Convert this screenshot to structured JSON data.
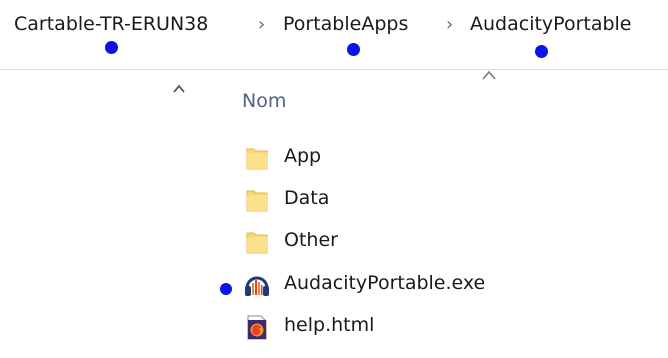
{
  "breadcrumb": {
    "items": [
      {
        "label": "Cartable-TR-ERUN38"
      },
      {
        "label": "PortableApps"
      },
      {
        "label": "AudacityPortable"
      }
    ],
    "separator": "›"
  },
  "column_header": {
    "label": "Nom"
  },
  "files": [
    {
      "name": "App",
      "icon": "folder-icon"
    },
    {
      "name": "Data",
      "icon": "folder-icon"
    },
    {
      "name": "Other",
      "icon": "folder-icon"
    },
    {
      "name": "AudacityPortable.exe",
      "icon": "audacity-app-icon"
    },
    {
      "name": "help.html",
      "icon": "html-file-icon"
    }
  ],
  "colors": {
    "annotation_dot": "#0a14e6",
    "folder_yellow": "#f8d775",
    "header_text": "#4e6386"
  }
}
